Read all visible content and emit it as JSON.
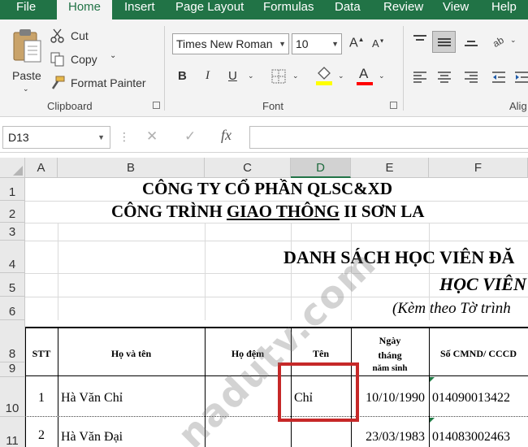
{
  "tabs": [
    {
      "label": "File"
    },
    {
      "label": "Home"
    },
    {
      "label": "Insert"
    },
    {
      "label": "Page Layout"
    },
    {
      "label": "Formulas"
    },
    {
      "label": "Data"
    },
    {
      "label": "Review"
    },
    {
      "label": "View"
    },
    {
      "label": "Help"
    }
  ],
  "clipboard": {
    "paste": "Paste",
    "cut": "Cut",
    "copy": "Copy",
    "format_painter": "Format Painter",
    "group_label": "Clipboard"
  },
  "font": {
    "family": "Times New Roman",
    "size": "10",
    "bold": "B",
    "italic": "I",
    "underline": "U",
    "group_label": "Font",
    "fill_color": "#ffff00",
    "font_color": "#ff0000"
  },
  "alignment": {
    "group_label": "Alig"
  },
  "formula_bar": {
    "name_box": "D13",
    "cancel": "✕",
    "enter": "✓",
    "fx": "fx",
    "value": ""
  },
  "columns": [
    "A",
    "B",
    "C",
    "D",
    "E",
    "F"
  ],
  "selected_column": "D",
  "rows": [
    "1",
    "2",
    "3",
    "4",
    "5",
    "6",
    "8",
    "9",
    "10",
    "11"
  ],
  "sheet": {
    "line1": "CÔNG TY CỔ PHẦN QLSC&XD",
    "line2_pre": "CÔNG TRÌNH ",
    "line2_under": "GIAO THÔNG",
    "line2_post": " II SƠN LA",
    "line4": "DANH SÁCH HỌC VIÊN ĐĂ",
    "line5": "HỌC VIÊN",
    "line6": "(Kèm theo Tờ trình",
    "headers": {
      "stt": "STT",
      "ho_va_ten": "Họ và tên",
      "ho_dem": "Họ đệm",
      "ten": "Tên",
      "ngay_sinh_1": "Ngày",
      "ngay_sinh_2": "tháng",
      "ngay_sinh_3": "năm sinh",
      "cmnd": "Số CMND/ CCCD"
    },
    "data_rows": [
      {
        "stt": "1",
        "ho_va_ten": "Hà Văn Chỉ",
        "ho_dem": "",
        "ten": "Chỉ",
        "ngay_sinh": "10/10/1990",
        "cmnd": "014090013422"
      },
      {
        "stt": "2",
        "ho_va_ten": "Hà Văn Đại",
        "ho_dem": "",
        "ten": "",
        "ngay_sinh": "23/03/1983",
        "cmnd": "014083002463"
      }
    ]
  },
  "watermark": "nadutv.com",
  "colors": {
    "accent": "#217346",
    "highlight_box": "#c62828"
  }
}
